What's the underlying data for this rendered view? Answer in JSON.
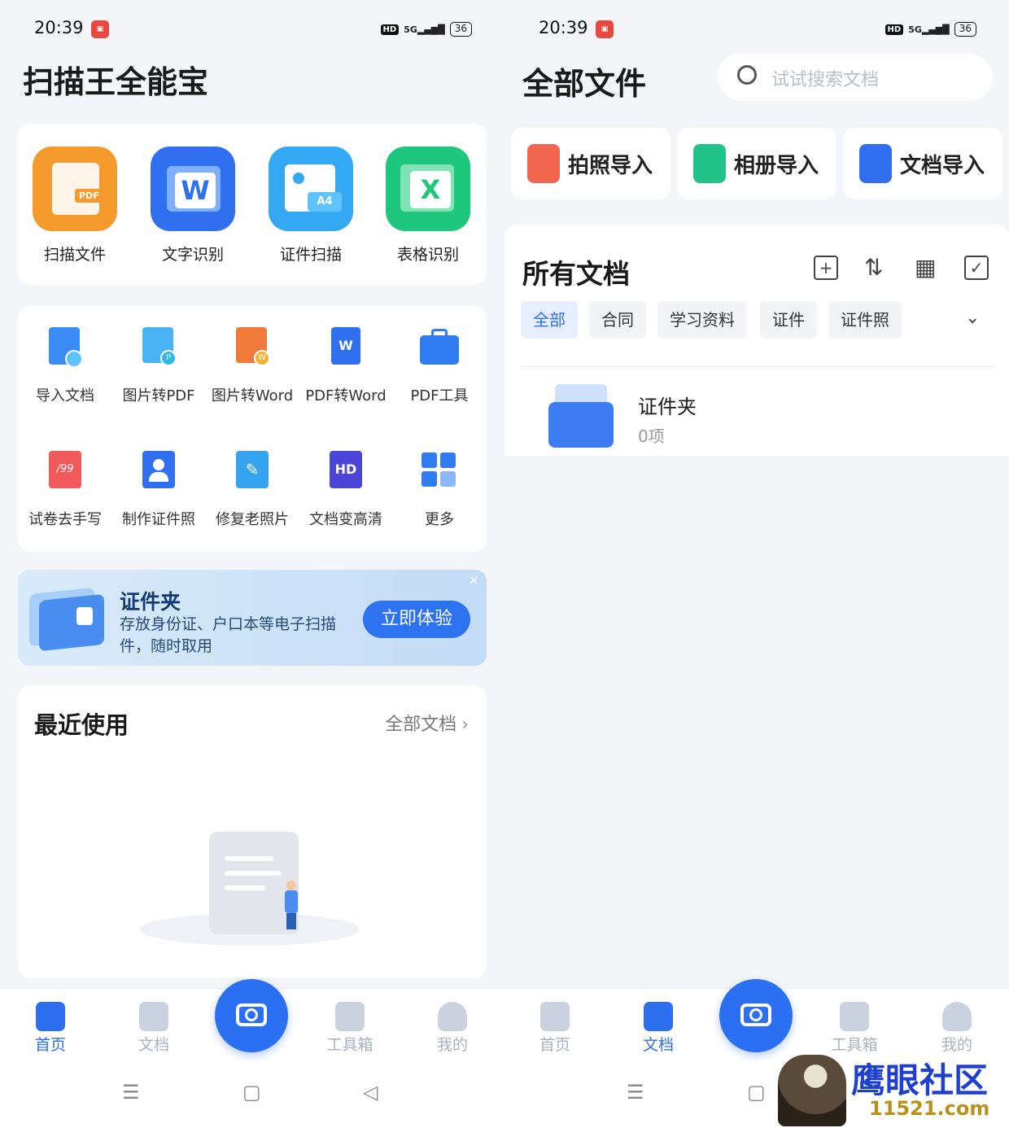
{
  "left": {
    "status": {
      "time": "20:39",
      "network": "5G",
      "battery": "36"
    },
    "title": "扫描王全能宝",
    "main_tiles": [
      {
        "label": "扫描文件",
        "icon": "pdf-scan-icon",
        "color": "#f59a2c"
      },
      {
        "label": "文字识别",
        "icon": "word-icon",
        "color": "#2f6ff0"
      },
      {
        "label": "证件扫描",
        "icon": "id-card-icon",
        "color": "#34a8f2"
      },
      {
        "label": "表格识别",
        "icon": "excel-icon",
        "color": "#1fc77e"
      }
    ],
    "tools": [
      {
        "label": "导入文档",
        "icon": "import-doc-icon"
      },
      {
        "label": "图片转PDF",
        "icon": "image-to-pdf-icon"
      },
      {
        "label": "图片转Word",
        "icon": "image-to-word-icon"
      },
      {
        "label": "PDF转Word",
        "icon": "pdf-to-word-icon"
      },
      {
        "label": "PDF工具",
        "icon": "pdf-tools-icon"
      },
      {
        "label": "试卷去手写",
        "icon": "remove-handwriting-icon"
      },
      {
        "label": "制作证件照",
        "icon": "id-photo-icon"
      },
      {
        "label": "修复老照片",
        "icon": "restore-photo-icon"
      },
      {
        "label": "文档变高清",
        "icon": "hd-icon"
      },
      {
        "label": "更多",
        "icon": "more-grid-icon"
      }
    ],
    "banner": {
      "title": "证件夹",
      "desc": "存放身份证、户口本等电子扫描件，随时取用",
      "button": "立即体验"
    },
    "recent": {
      "title": "最近使用",
      "link": "全部文档"
    },
    "tabs": [
      {
        "label": "首页",
        "active": true
      },
      {
        "label": "文档",
        "active": false
      },
      {
        "label": "工具箱",
        "active": false
      },
      {
        "label": "我的",
        "active": false
      }
    ]
  },
  "right": {
    "status": {
      "time": "20:39",
      "network": "5G",
      "battery": "36"
    },
    "title": "全部文件",
    "search_placeholder": "试试搜索文档",
    "imports": [
      {
        "label": "拍照导入",
        "icon": "camera-import-icon",
        "color": "#f0664f"
      },
      {
        "label": "相册导入",
        "icon": "album-import-icon",
        "color": "#20c48a"
      },
      {
        "label": "文档导入",
        "icon": "doc-import-icon",
        "color": "#2f6ff0"
      }
    ],
    "section_title": "所有文档",
    "chips": [
      "全部",
      "合同",
      "学习资料",
      "证件",
      "证件照"
    ],
    "folder": {
      "name": "证件夹",
      "count": "0项"
    },
    "tabs": [
      {
        "label": "首页",
        "active": false
      },
      {
        "label": "文档",
        "active": true
      },
      {
        "label": "工具箱",
        "active": false
      },
      {
        "label": "我的",
        "active": false
      }
    ]
  },
  "watermark": {
    "name": "鹰眼社区",
    "site": "11521.com"
  }
}
